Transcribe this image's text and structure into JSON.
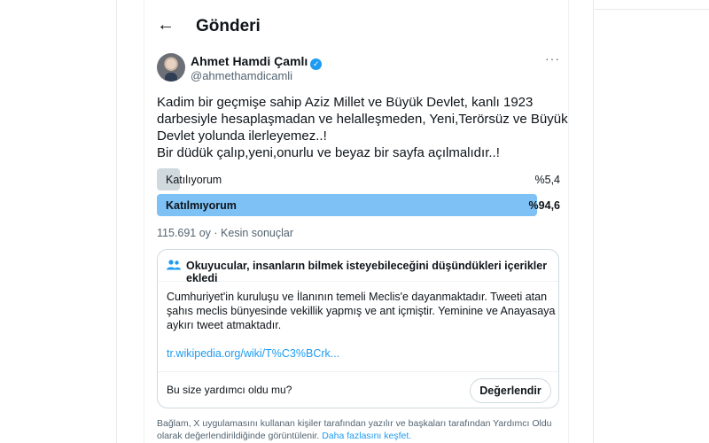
{
  "header": {
    "title": "Gönderi",
    "back_icon": "←"
  },
  "author": {
    "name": "Ahmet Hamdi Çamlı",
    "handle": "@ahmethamdicamli",
    "verified_icon": "✓"
  },
  "more_icon": "···",
  "tweet": {
    "lines": [
      "Kadim bir geçmişe sahip Aziz Millet  ve Büyük Devlet, kanlı 1923",
      "darbesiyle hesaplaşmadan ve helalleşmeden, Yeni,Terörsüz ve Büyük",
      "Devlet yolunda ilerleyemez..!",
      "Bir düdük çalıp,yeni,onurlu ve beyaz bir sayfa açılmalıdır..!"
    ]
  },
  "poll": {
    "options": [
      {
        "label": "Katılıyorum",
        "percent_text": "%5,4",
        "value": 5.4
      },
      {
        "label": "Katılmıyorum",
        "percent_text": "%94,6",
        "value": 94.6
      }
    ],
    "meta": "115.691 oy · Kesin sonuçlar"
  },
  "community_note": {
    "title": "Okuyucular, insanların bilmek isteyebileceğini düşündükleri içerikler ekledi",
    "body_lines": [
      "Cumhuriyet'in kuruluşu ve İlanının temeli Meclis'e dayanmaktadır. Tweeti atan",
      "şahıs meclis bünyesinde vekillik yapmış ve ant içmiştir. Yeminine ve Anayasaya",
      "aykırı tweet atmaktadır."
    ],
    "link": "tr.wikipedia.org/wiki/T%C3%BCrk...",
    "helpful_question": "Bu size yardımcı oldu mu?",
    "rate_button": "Değerlendir"
  },
  "footer": {
    "line1": "Bağlam, X uygulamasını kullanan kişiler tarafından yazılır ve başkaları tarafından Yardımcı Oldu",
    "line2": "olarak değerlendirildiğinde görüntülenir.",
    "link": "Daha fazlasını keşfet."
  },
  "colors": {
    "accent": "#1d9bf0",
    "poll_winner": "#7ec1f4",
    "poll_loser": "#cfd9de"
  }
}
